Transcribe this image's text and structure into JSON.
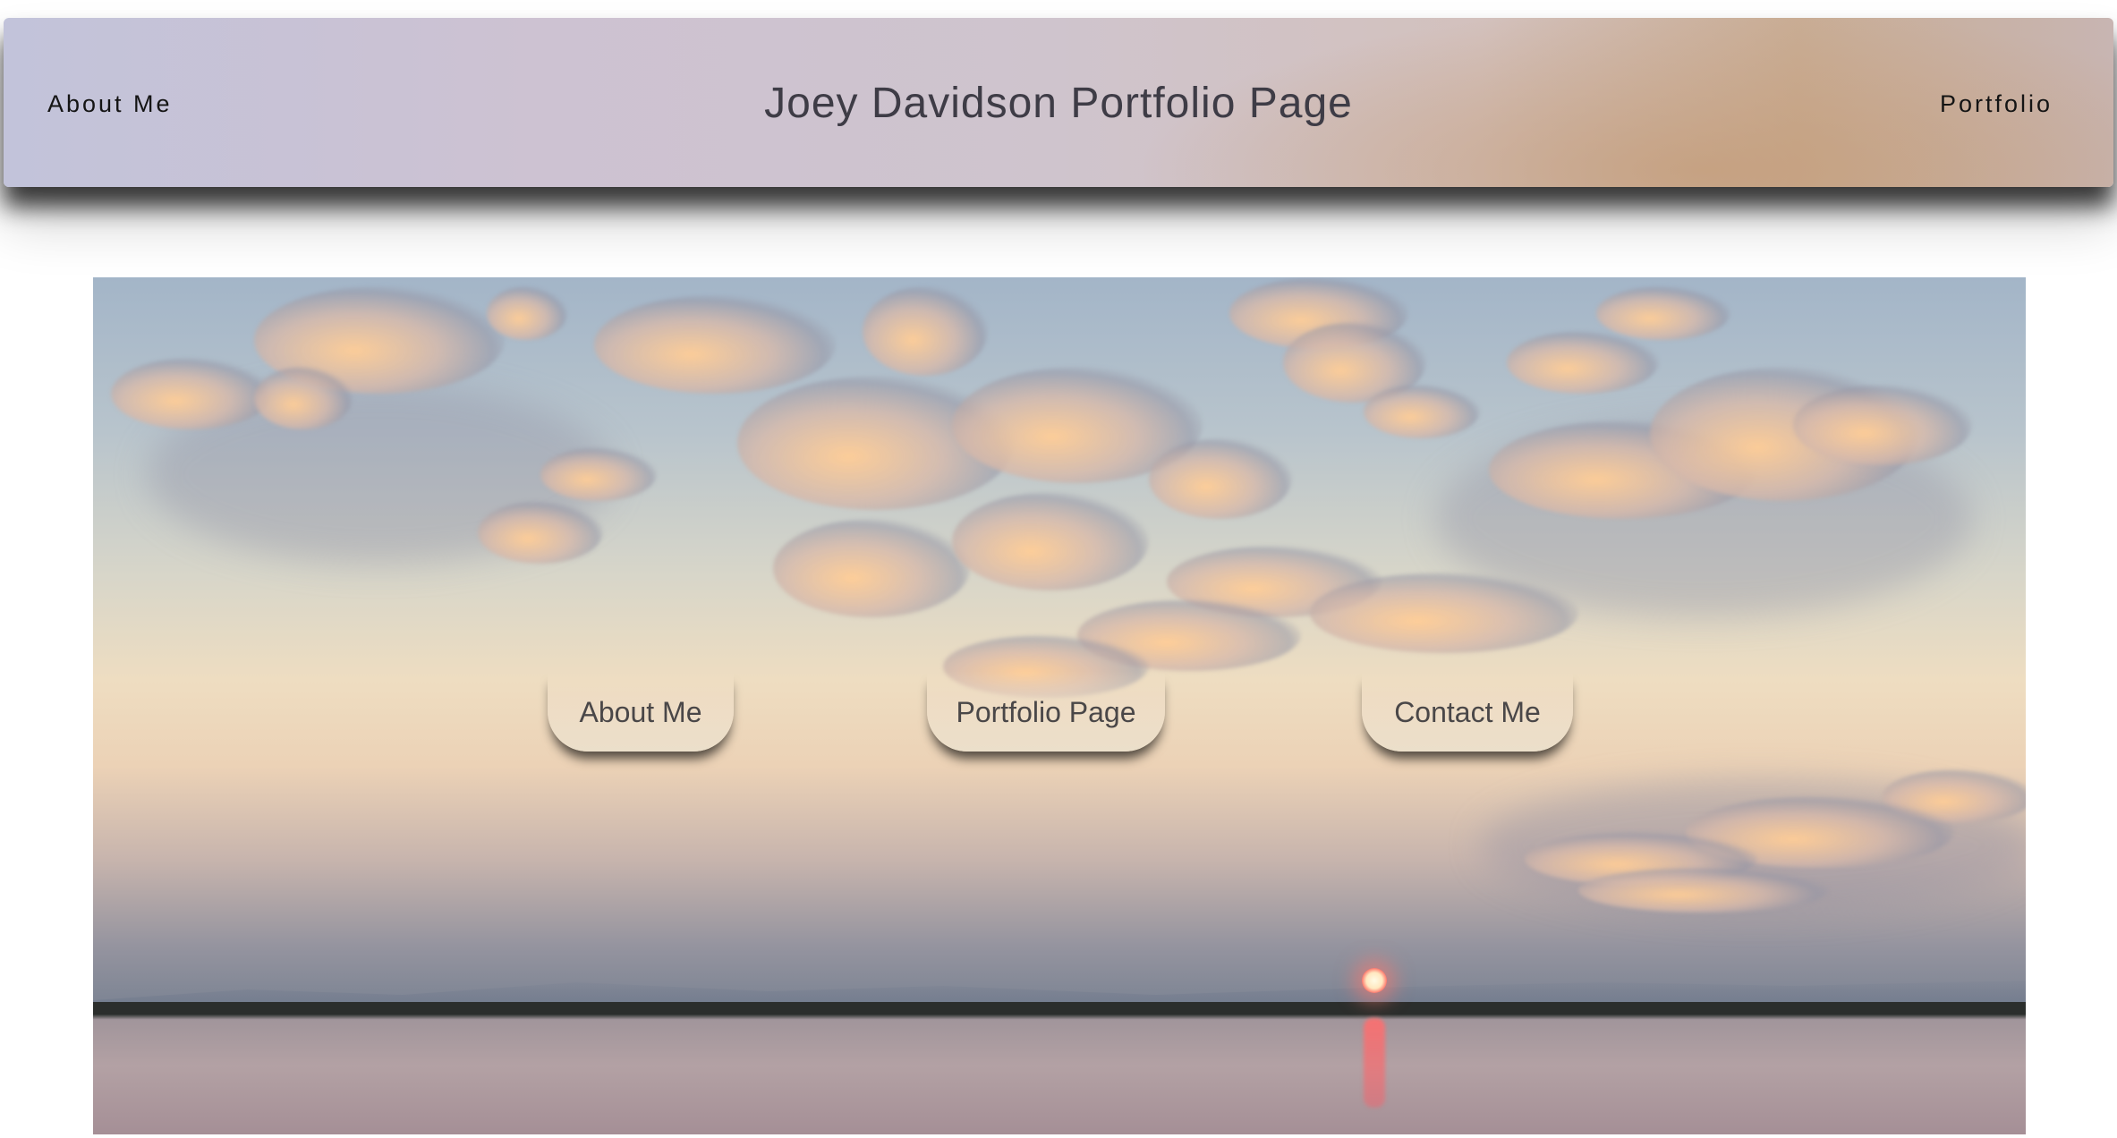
{
  "header": {
    "nav_left": "About Me",
    "title": "Joey Davidson Portfolio Page",
    "nav_right": "Portfolio"
  },
  "hero": {
    "image_subject": "sunset over lake",
    "buttons": [
      {
        "label": "About Me"
      },
      {
        "label": "Portfolio Page"
      },
      {
        "label": "Contact Me"
      }
    ]
  },
  "colors": {
    "header_left": "#c2c3da",
    "header_right": "#c9ad95",
    "button_bg": "#ebdfca",
    "text_dark": "#141414",
    "title_text": "#3e3c46"
  }
}
